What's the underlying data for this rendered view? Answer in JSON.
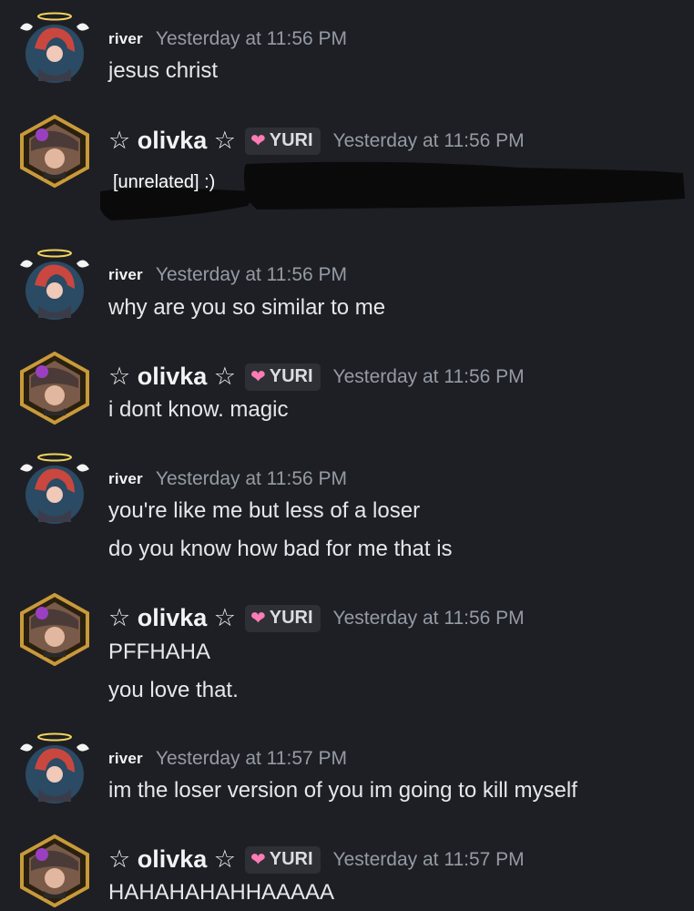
{
  "users": {
    "river": {
      "name": "river"
    },
    "olivka": {
      "name": "☆ olivka ☆",
      "tag": "YURI",
      "tag_icon": "pink-heart-icon"
    }
  },
  "colors": {
    "background": "#1e1f24",
    "text": "#e6e7ea",
    "timestamp": "#949ba4",
    "tag_bg": "#2e3036",
    "heart": "#ff7bb5"
  },
  "messages": [
    {
      "author": "river",
      "timestamp": "Yesterday at 11:56 PM",
      "lines": [
        "jesus christ"
      ]
    },
    {
      "author": "olivka",
      "timestamp": "Yesterday at 11:56 PM",
      "lines": [
        "[unrelated] :)"
      ]
    },
    {
      "author": "river",
      "timestamp": "Yesterday at 11:56 PM",
      "lines": [
        "why are you so similar to me"
      ]
    },
    {
      "author": "olivka",
      "timestamp": "Yesterday at 11:56 PM",
      "lines": [
        "i dont know. magic"
      ]
    },
    {
      "author": "river",
      "timestamp": "Yesterday at 11:56 PM",
      "lines": [
        "you're like me but less of a loser",
        "do you know how bad for me that is"
      ]
    },
    {
      "author": "olivka",
      "timestamp": "Yesterday at 11:56 PM",
      "lines": [
        "PFFHAHA",
        "you love that."
      ]
    },
    {
      "author": "river",
      "timestamp": "Yesterday at 11:57 PM",
      "lines": [
        "im the loser version of you im going to kill myself"
      ]
    },
    {
      "author": "olivka",
      "timestamp": "Yesterday at 11:57 PM",
      "lines": [
        "HAHAHAHAHHAAAAA"
      ]
    }
  ]
}
